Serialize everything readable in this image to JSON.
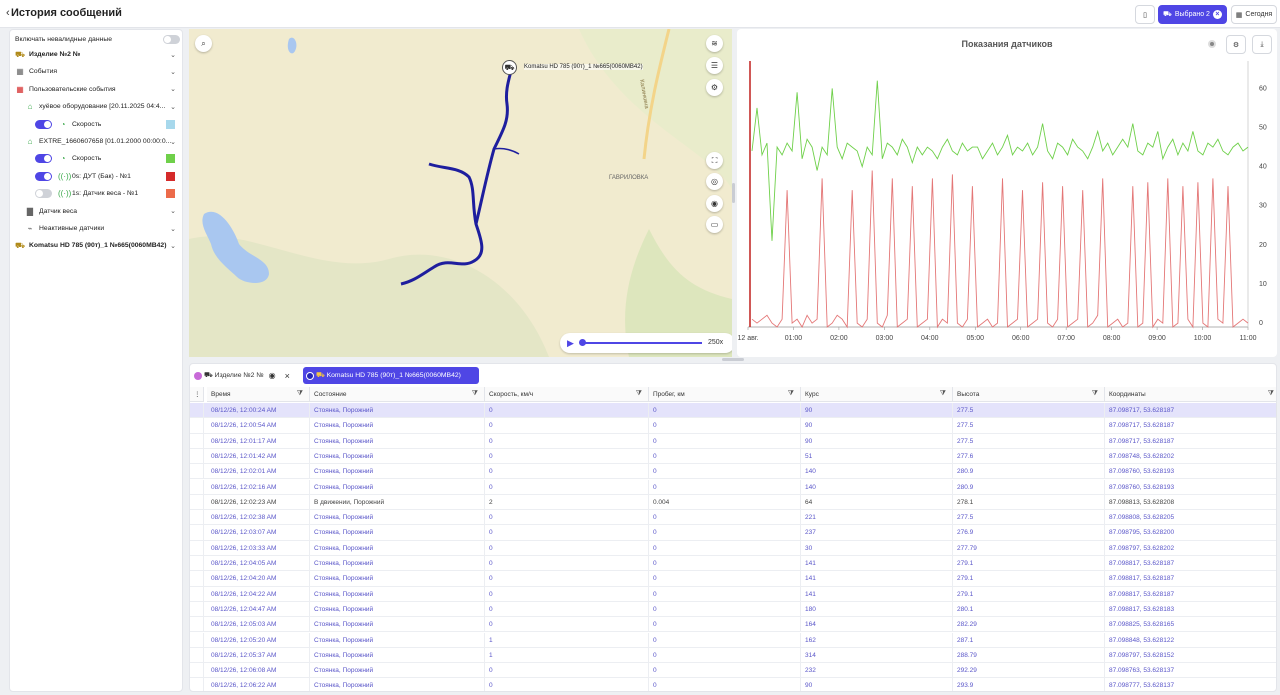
{
  "header": {
    "title": "История сообщений",
    "selected_label": "Выбрано 2",
    "today_label": "Сегодня"
  },
  "left_panel": {
    "invalid_toggle_label": "Включать невалидные данные",
    "rows": [
      {
        "label": "Изделие №2 №",
        "icon": "truck-icon",
        "indent": 0
      },
      {
        "label": "События",
        "icon": "calendar-icon",
        "indent": 0
      },
      {
        "label": "Пользовательские события",
        "icon": "calendar-red-icon",
        "indent": 0
      },
      {
        "label": "хуёвое оборудование [20.11.2025 04:4...",
        "icon": "equipment-icon",
        "indent": 1
      },
      {
        "label": "Скорость",
        "icon": "speedometer-icon",
        "indent": 2,
        "toggle": true,
        "swatch": "#a7d8ec"
      },
      {
        "label": "EXTRE_1660607658 [01.01.2000 00:00:0...",
        "icon": "equipment-icon",
        "indent": 1
      },
      {
        "label": "Скорость",
        "icon": "speedometer-icon",
        "indent": 2,
        "toggle": true,
        "swatch": "#6fd04a"
      },
      {
        "label": "0s: ДУТ (Бак) - №1",
        "icon": "sensor-icon",
        "indent": 2,
        "toggle": true,
        "swatch": "#d52a2a"
      },
      {
        "label": "1s: Датчик веса - №1",
        "icon": "sensor-icon",
        "indent": 2,
        "toggle": false,
        "swatch": "#ec6b4a"
      },
      {
        "label": "Датчик веса",
        "icon": "folder-icon",
        "indent": 1
      },
      {
        "label": "Неактивные датчики",
        "icon": "sensor-off-icon",
        "indent": 1
      },
      {
        "label": "Komatsu HD 785 (90т)_1 №665(0060МВ42)",
        "icon": "dump-truck-icon",
        "indent": 0
      }
    ]
  },
  "map": {
    "vehicle_label": "Komatsu HD 785 (90т)_1 №665(0060МВ42)",
    "place_label": "ГАВРИЛОВКА",
    "road_label": "Калинкина",
    "speed_label": "250x"
  },
  "chart_data": {
    "type": "line",
    "title": "Показания датчиков",
    "x_ticks": [
      "12 авг.",
      "01:00",
      "02:00",
      "03:00",
      "04:00",
      "05:00",
      "06:00",
      "07:00",
      "08:00",
      "09:00",
      "10:00",
      "11:00"
    ],
    "y_ticks": [
      0,
      10,
      20,
      30,
      40,
      50,
      60
    ],
    "ylim": [
      0,
      68
    ],
    "series": [
      {
        "color": "#6fd04a",
        "values": [
          45,
          56,
          44,
          47,
          22,
          46,
          44,
          47,
          45,
          60,
          43,
          48,
          46,
          40,
          46,
          44,
          61,
          46,
          43,
          47,
          46,
          45,
          41,
          46,
          44,
          63,
          43,
          47,
          46,
          44,
          48,
          46,
          42,
          46,
          44,
          46,
          45,
          43,
          46,
          48,
          45,
          44,
          47,
          45,
          46,
          46,
          43,
          45,
          47,
          44,
          46,
          49,
          44,
          46,
          45,
          47,
          44,
          46,
          52,
          45,
          43,
          47,
          46,
          44,
          48,
          46,
          45,
          43,
          46,
          50,
          45,
          47,
          44,
          46,
          48,
          46,
          52,
          45,
          44,
          47,
          46,
          50,
          43,
          46,
          48,
          44,
          47,
          45,
          50,
          45,
          44,
          47,
          46,
          48,
          45,
          44,
          46,
          47,
          45,
          46
        ]
      },
      {
        "color": "#e47777",
        "values": [
          2,
          1,
          2,
          3,
          1,
          0,
          2,
          35,
          1,
          2,
          0,
          3,
          1,
          2,
          38,
          0,
          1,
          3,
          2,
          0,
          35,
          1,
          0,
          2,
          40,
          1,
          0,
          3,
          38,
          0,
          1,
          2,
          36,
          0,
          1,
          2,
          38,
          0,
          2,
          1,
          39,
          1,
          0,
          2,
          36,
          0,
          1,
          2,
          0,
          1,
          38,
          0,
          1,
          2,
          35,
          0,
          1,
          2,
          37,
          1,
          0,
          2,
          36,
          0,
          1,
          2,
          35,
          0,
          1,
          3,
          38,
          0,
          1,
          2,
          0,
          1,
          36,
          0,
          1,
          37,
          0,
          2,
          1,
          38,
          0,
          1,
          36,
          2,
          0,
          37,
          1,
          0,
          38,
          2,
          1,
          36,
          0,
          1,
          2,
          1
        ]
      }
    ],
    "markers": [
      {
        "x": 0,
        "color": "#c0201e"
      }
    ]
  },
  "table": {
    "tabs": [
      {
        "label": "Изделие №2 №",
        "color": "#c86ad8"
      },
      {
        "label": "Komatsu HD 785 (90т)_1 №665(0060МВ42)",
        "color": "#2626b8"
      }
    ],
    "columns": [
      "Время",
      "Состояние",
      "Скорость, км/ч",
      "Пробег, км",
      "Курс",
      "Высота",
      "Координаты"
    ],
    "rows": [
      [
        "08/12/26, 12:00:24 AM",
        "Стоянка, Порожний",
        "0",
        "0",
        "90",
        "277.5",
        "87.098717, 53.628187"
      ],
      [
        "08/12/26, 12:00:54 AM",
        "Стоянка, Порожний",
        "0",
        "0",
        "90",
        "277.5",
        "87.098717, 53.628187"
      ],
      [
        "08/12/26, 12:01:17 AM",
        "Стоянка, Порожний",
        "0",
        "0",
        "90",
        "277.5",
        "87.098717, 53.628187"
      ],
      [
        "08/12/26, 12:01:42 AM",
        "Стоянка, Порожний",
        "0",
        "0",
        "51",
        "277.6",
        "87.098748, 53.628202"
      ],
      [
        "08/12/26, 12:02:01 AM",
        "Стоянка, Порожний",
        "0",
        "0",
        "140",
        "280.9",
        "87.098760, 53.628193"
      ],
      [
        "08/12/26, 12:02:16 AM",
        "Стоянка, Порожний",
        "0",
        "0",
        "140",
        "280.9",
        "87.098760, 53.628193"
      ],
      [
        "08/12/26, 12:02:23 AM",
        "В движении, Порожний",
        "2",
        "0.004",
        "64",
        "278.1",
        "87.098813, 53.628208"
      ],
      [
        "08/12/26, 12:02:38 AM",
        "Стоянка, Порожний",
        "0",
        "0",
        "221",
        "277.5",
        "87.098808, 53.628205"
      ],
      [
        "08/12/26, 12:03:07 AM",
        "Стоянка, Порожний",
        "0",
        "0",
        "237",
        "276.9",
        "87.098795, 53.628200"
      ],
      [
        "08/12/26, 12:03:33 AM",
        "Стоянка, Порожний",
        "0",
        "0",
        "30",
        "277.79",
        "87.098797, 53.628202"
      ],
      [
        "08/12/26, 12:04:05 AM",
        "Стоянка, Порожний",
        "0",
        "0",
        "141",
        "279.1",
        "87.098817, 53.628187"
      ],
      [
        "08/12/26, 12:04:20 AM",
        "Стоянка, Порожний",
        "0",
        "0",
        "141",
        "279.1",
        "87.098817, 53.628187"
      ],
      [
        "08/12/26, 12:04:22 AM",
        "Стоянка, Порожний",
        "0",
        "0",
        "141",
        "279.1",
        "87.098817, 53.628187"
      ],
      [
        "08/12/26, 12:04:47 AM",
        "Стоянка, Порожний",
        "0",
        "0",
        "180",
        "280.1",
        "87.098817, 53.628183"
      ],
      [
        "08/12/26, 12:05:03 AM",
        "Стоянка, Порожний",
        "0",
        "0",
        "164",
        "282.29",
        "87.098825, 53.628165"
      ],
      [
        "08/12/26, 12:05:20 AM",
        "Стоянка, Порожний",
        "1",
        "0",
        "162",
        "287.1",
        "87.098848, 53.628122"
      ],
      [
        "08/12/26, 12:05:37 AM",
        "Стоянка, Порожний",
        "1",
        "0",
        "314",
        "288.79",
        "87.098797, 53.628152"
      ],
      [
        "08/12/26, 12:06:08 AM",
        "Стоянка, Порожний",
        "0",
        "0",
        "232",
        "292.29",
        "87.098763, 53.628137"
      ],
      [
        "08/12/26, 12:06:22 AM",
        "Стоянка, Порожний",
        "0",
        "0",
        "90",
        "293.9",
        "87.098777, 53.628137"
      ]
    ]
  }
}
